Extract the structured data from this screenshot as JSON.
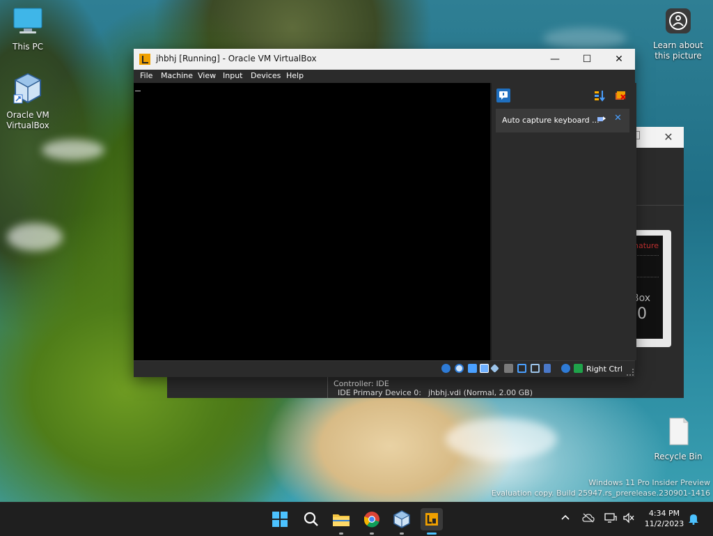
{
  "desktop": {
    "icons": [
      {
        "label": "This PC"
      },
      {
        "label": "Oracle VM VirtualBox"
      },
      {
        "label": "Learn about this picture"
      },
      {
        "label": "Recycle Bin"
      }
    ],
    "watermark": {
      "line1": "Windows 11 Pro Insider Preview",
      "line2": "Evaluation copy. Build 25947.rs_prerelease.230901-1416"
    }
  },
  "background_window": {
    "close_glyph": "✕",
    "preview_text": {
      "brand": "nature",
      "box": "Box",
      "version": ".0"
    },
    "details": {
      "controller": "Controller: IDE",
      "device_label": "IDE Primary Device 0:",
      "device_value": "jhbhj.vdi (Normal, 2.00 GB)"
    }
  },
  "vbox_window": {
    "title": "jhbhj [Running] - Oracle VM VirtualBox",
    "controls": {
      "minimize": "—",
      "maximize": "☐",
      "close": "✕"
    },
    "menu": [
      "File",
      "Machine",
      "View",
      "Input",
      "Devices",
      "Help"
    ],
    "notification": {
      "text": "Auto capture keyboard ...",
      "close_glyph": "✕"
    },
    "statusbar": {
      "host_key": "Right Ctrl",
      "icons": [
        "hard-disk-icon",
        "optical-drive-icon",
        "audio-icon",
        "network-icon",
        "usb-icon",
        "shared-folders-icon",
        "display-icon",
        "recording-icon",
        "cpu-icon",
        "mouse-integration-icon",
        "keyboard-icon"
      ]
    }
  },
  "taskbar": {
    "apps": [
      "start-icon",
      "search-icon",
      "file-explorer-icon",
      "chrome-icon",
      "virtualbox-manager-icon",
      "virtualbox-vm-icon"
    ],
    "clock": {
      "time": "4:34 PM",
      "date": "11/2/2023"
    }
  },
  "colors": {
    "taskbar": "#1f1f1f",
    "window_dark": "#2b2b2b",
    "accent": "#4cc2ff",
    "vbox_orange": "#f0a000"
  }
}
